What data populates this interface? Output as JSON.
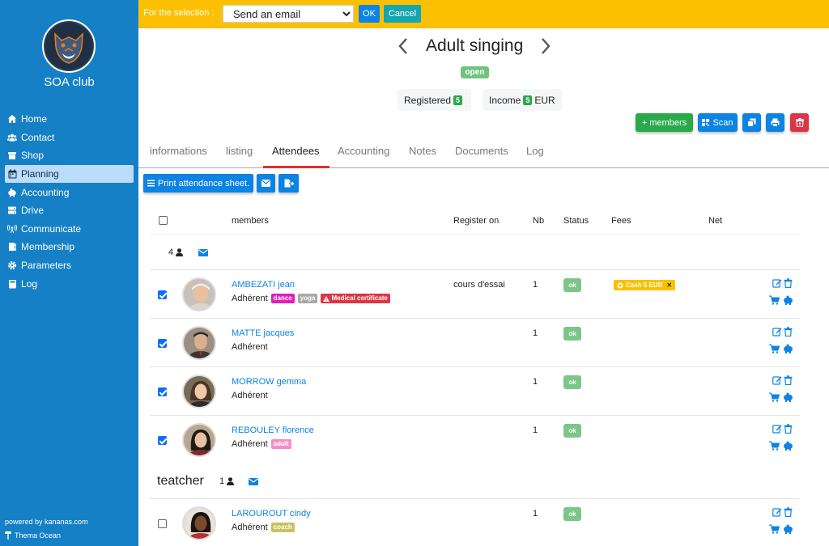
{
  "app": {
    "club_name": "SOA club",
    "powered": "powered by kananas.com",
    "theme": "Thema Ocean"
  },
  "sidebar": {
    "items": [
      {
        "label": "Home",
        "icon": "home-icon"
      },
      {
        "label": "Contact",
        "icon": "users-icon"
      },
      {
        "label": "Shop",
        "icon": "shop-icon"
      },
      {
        "label": "Planning",
        "icon": "calendar-icon",
        "active": true
      },
      {
        "label": "Accounting",
        "icon": "piggy-bank-icon"
      },
      {
        "label": "Drive",
        "icon": "drive-icon"
      },
      {
        "label": "Communicate",
        "icon": "broadcast-icon"
      },
      {
        "label": "Membership",
        "icon": "membership-icon"
      },
      {
        "label": "Parameters",
        "icon": "gear-icon"
      },
      {
        "label": "Log",
        "icon": "log-icon"
      }
    ]
  },
  "topbar": {
    "selection_label": "For the selection :",
    "action_value": "Send an email",
    "ok_label": "OK",
    "cancel_label": "Cancel"
  },
  "header": {
    "title": "Adult singing",
    "status": "open",
    "registered_label": "Registered",
    "registered_count": "5",
    "income_label": "Income",
    "income_count": "5",
    "income_unit": "EUR"
  },
  "actions": {
    "add_members_label": "+ members",
    "scan_label": "Scan"
  },
  "tabs": [
    "informations",
    "listing",
    "Attendees",
    "Accounting",
    "Notes",
    "Documents",
    "Log"
  ],
  "active_tab": "Attendees",
  "toolbar": {
    "print_label": "Print attendance sheet."
  },
  "table": {
    "headers": {
      "members": "members",
      "register_on": "Register on",
      "nb": "Nb",
      "status": "Status",
      "fees": "Fees",
      "net": "Net"
    }
  },
  "groups": [
    {
      "title": "",
      "count": "4"
    },
    {
      "title": "teatcher",
      "count": "1"
    }
  ],
  "rows": [
    {
      "name": "AMBEZATI jean",
      "role": "Adhérent",
      "tags": [
        {
          "text": "dance",
          "color": "#e01ebd"
        },
        {
          "text": "yoga",
          "color": "#a9a9a9"
        },
        {
          "text": "Medical certificate",
          "color": "#dc3545",
          "warn": true
        }
      ],
      "register_on": "cours d'essai",
      "nb": "1",
      "status": "ok",
      "fee": "Cash 5 EUR",
      "checked": true
    },
    {
      "name": "MATTE jacques",
      "role": "Adhérent",
      "tags": [],
      "register_on": "",
      "nb": "1",
      "status": "ok",
      "fee": "",
      "checked": true
    },
    {
      "name": "MORROW gemma",
      "role": "Adhérent",
      "tags": [],
      "register_on": "",
      "nb": "1",
      "status": "ok",
      "fee": "",
      "checked": true
    },
    {
      "name": "REBOULEY florence",
      "role": "Adhérent",
      "tags": [
        {
          "text": "adult",
          "color": "#f48fc6"
        }
      ],
      "register_on": "",
      "nb": "1",
      "status": "ok",
      "fee": "",
      "checked": true
    },
    {
      "name": "LAROUROUT cindy",
      "role": "Adhérent",
      "tags": [
        {
          "text": "coach",
          "color": "#c7c261"
        }
      ],
      "register_on": "",
      "nb": "1",
      "status": "ok",
      "fee": "",
      "checked": false
    }
  ],
  "colors": {
    "sidebar": "#1580c6",
    "topbar": "#fdc000",
    "primary": "#0d83e3",
    "success": "#2aa94a",
    "danger": "#dc3545",
    "teal": "#16a6b2"
  }
}
